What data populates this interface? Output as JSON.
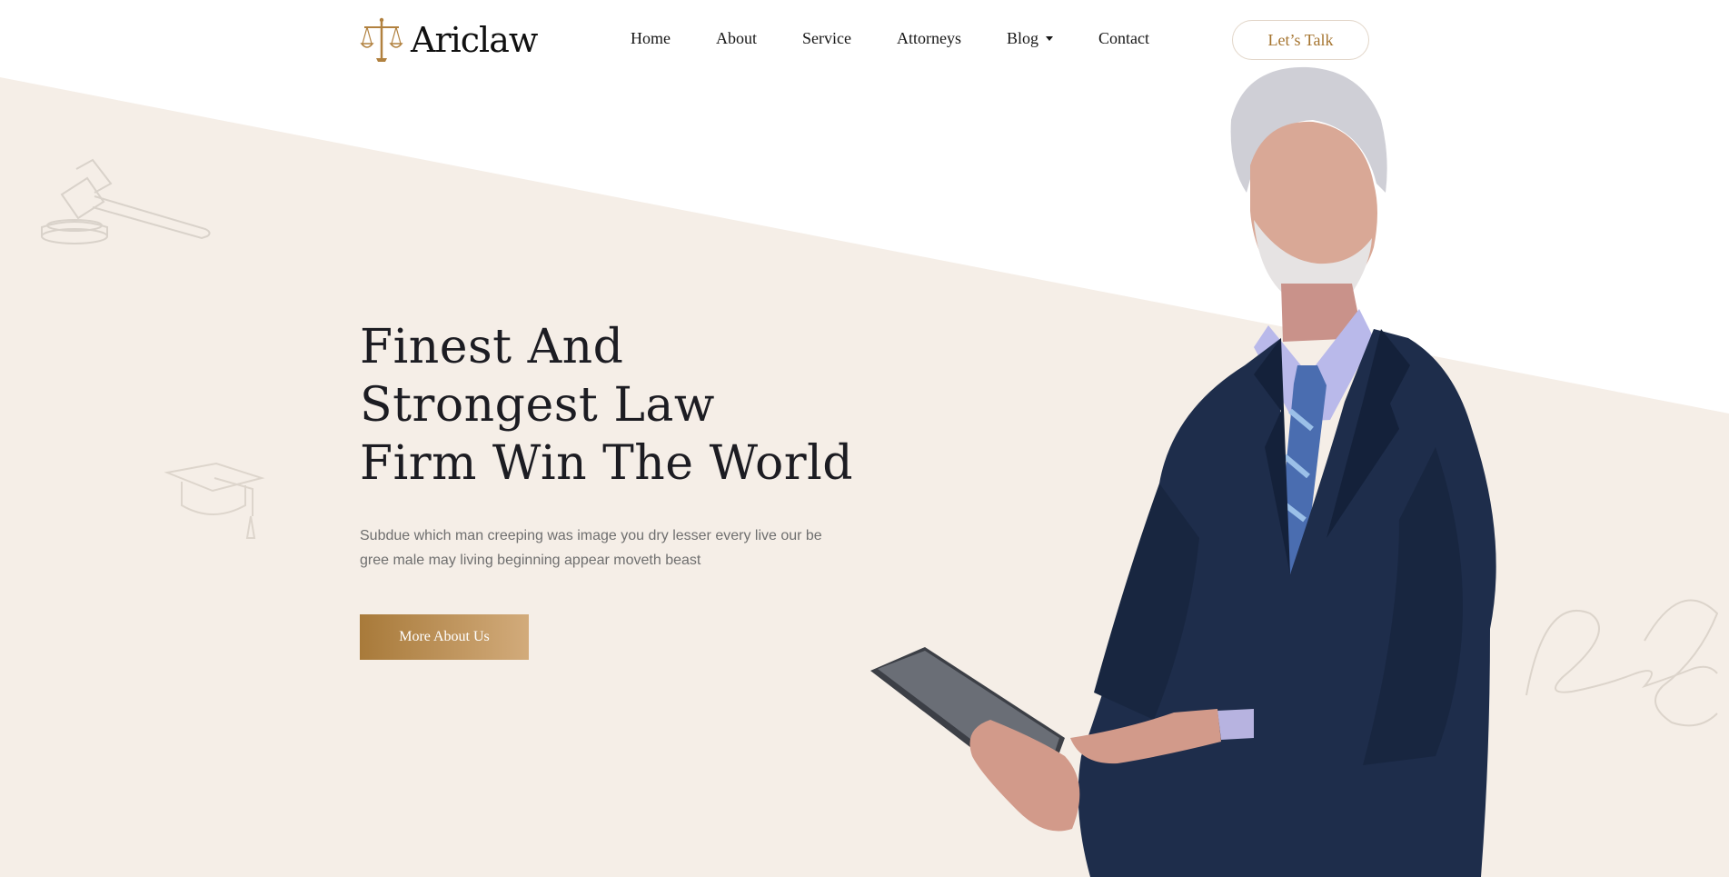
{
  "brand": {
    "name": "Ariclaw",
    "logo_icon": "scales-of-justice-icon",
    "accent": "#b1813f"
  },
  "nav": {
    "items": [
      {
        "label": "Home"
      },
      {
        "label": "About"
      },
      {
        "label": "Service"
      },
      {
        "label": "Attorneys"
      },
      {
        "label": "Blog",
        "has_dropdown": true
      },
      {
        "label": "Contact"
      }
    ],
    "cta_label": "Let’s Talk"
  },
  "hero": {
    "title_lines": [
      "Finest And",
      "Strongest Law",
      "Firm Win The World"
    ],
    "text": "Subdue which man creeping was image you dry lesser every live our be gree male may living beginning appear moveth beast",
    "button_label": "More About Us"
  },
  "decor": {
    "icons": [
      "gavel-icon",
      "graduation-cap-icon",
      "signature-icon"
    ],
    "image": "attorney-holding-tablet-image"
  },
  "colors": {
    "hero_bg": "#f5eee7",
    "button_start": "#a87a3a",
    "button_end": "#d2ab7b",
    "heading": "#1c1c22",
    "body_text": "#6f6f6f"
  }
}
